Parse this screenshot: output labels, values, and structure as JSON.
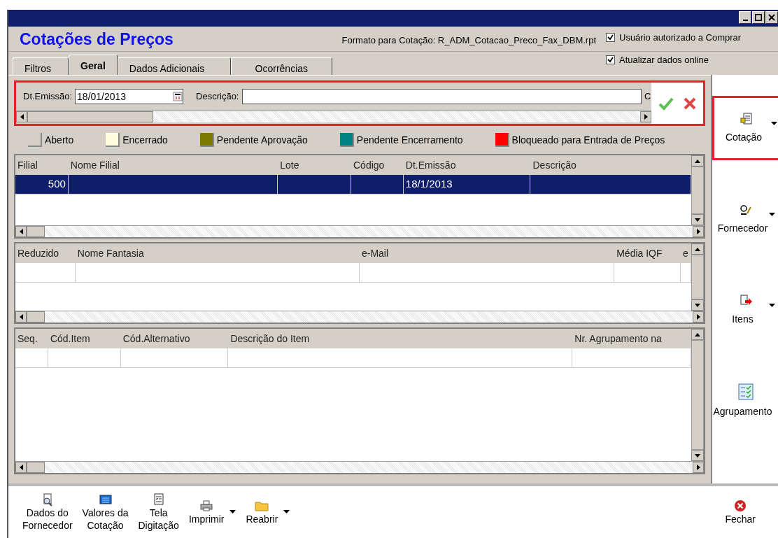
{
  "window": {
    "title": "Cotações de Preços",
    "format_label": "Formato para Cotação: R_ADM_Cotacao_Preco_Fax_DBM.rpt"
  },
  "options": [
    {
      "label": "Usuário autorizado a Comprar",
      "checked": true
    },
    {
      "label": "Atualizar dados online",
      "checked": true
    }
  ],
  "tabs": [
    {
      "label": "Filtros",
      "selected": false
    },
    {
      "label": "Geral",
      "selected": true
    },
    {
      "label": "Dados Adicionais",
      "selected": false
    },
    {
      "label": "Ocorrências",
      "selected": false
    }
  ],
  "filter": {
    "highlighted": true,
    "date_label": "Dt.Emissão:",
    "date_value": "18/01/2013",
    "description_label": "Descrição:",
    "cut_label": "C"
  },
  "legend": [
    {
      "label": "Aberto",
      "color": "#d4d0c8"
    },
    {
      "label": "Encerrado",
      "color": "#fffde0"
    },
    {
      "label": "Pendente Aprovação",
      "color": "#7b7b00"
    },
    {
      "label": "Pendente Encerramento",
      "color": "#008080"
    },
    {
      "label": "Bloqueado para Entrada de Preços",
      "color": "#ff0000"
    }
  ],
  "grids": [
    {
      "columns": [
        "Filial",
        "Nome Filial",
        "Lote",
        "Código",
        "Dt.Emissão",
        "Descrição"
      ],
      "rows": [
        {
          "selected": true,
          "cells": [
            "500",
            "",
            "",
            "",
            "18/1/2013",
            ""
          ]
        }
      ]
    },
    {
      "columns": [
        "Reduzido",
        "Nome Fantasia",
        "e-Mail",
        "Média IQF",
        "e"
      ]
    },
    {
      "columns": [
        "Seq.",
        "Cód.Item",
        "Cód.Alternativo",
        "Descrição do Item",
        "Nr. Agrupamento na"
      ]
    }
  ],
  "sidebar": [
    {
      "kind": "quote",
      "label": "Cotação",
      "has_menu": true,
      "highlighted": true
    },
    {
      "kind": "supplier",
      "label": "Fornecedor",
      "has_menu": true,
      "highlighted": false
    },
    {
      "kind": "items",
      "label": "Itens",
      "has_menu": true,
      "highlighted": false
    },
    {
      "kind": "grouping",
      "label": "Agrupamento",
      "has_menu": false,
      "highlighted": false
    }
  ],
  "toolbar": [
    {
      "kind": "supplier-data",
      "lines": [
        "Dados do",
        "Fornecedor"
      ],
      "has_menu": false
    },
    {
      "kind": "values",
      "lines": [
        "Valores da",
        "Cotação"
      ],
      "has_menu": false
    },
    {
      "kind": "typing",
      "lines": [
        "Tela",
        "Digitação"
      ],
      "has_menu": false
    },
    {
      "kind": "print",
      "lines": [
        "Imprimir"
      ],
      "has_menu": true
    },
    {
      "kind": "reopen",
      "lines": [
        "Reabrir"
      ],
      "has_menu": true
    },
    {
      "kind": "close",
      "lines": [
        "Fechar"
      ],
      "has_menu": false
    }
  ]
}
